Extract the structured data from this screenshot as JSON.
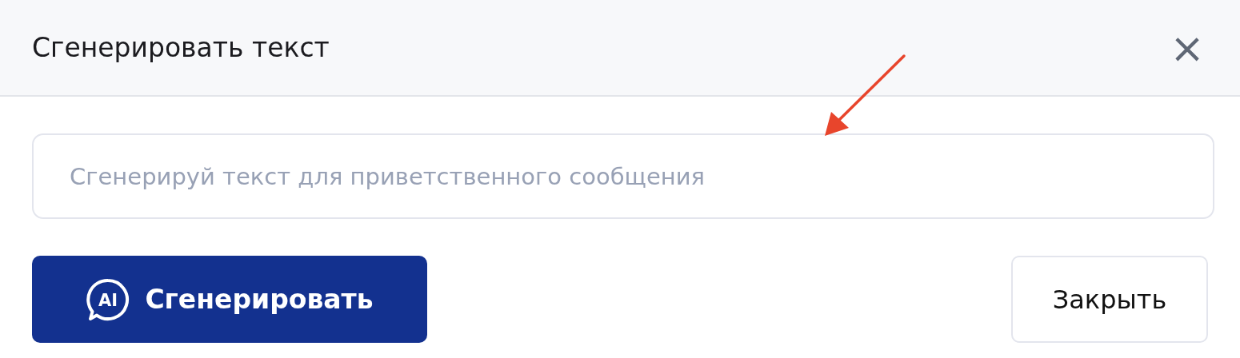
{
  "dialog": {
    "title": "Сгенерировать текст",
    "close_glyph": "×"
  },
  "prompt_field": {
    "placeholder": "Сгенерируй текст для приветственного сообщения"
  },
  "buttons": [
    {
      "kind": "primary",
      "label": "Сгенерировать",
      "icon_text": "AI"
    },
    {
      "kind": "secondary",
      "label": "Закрыть"
    }
  ]
}
